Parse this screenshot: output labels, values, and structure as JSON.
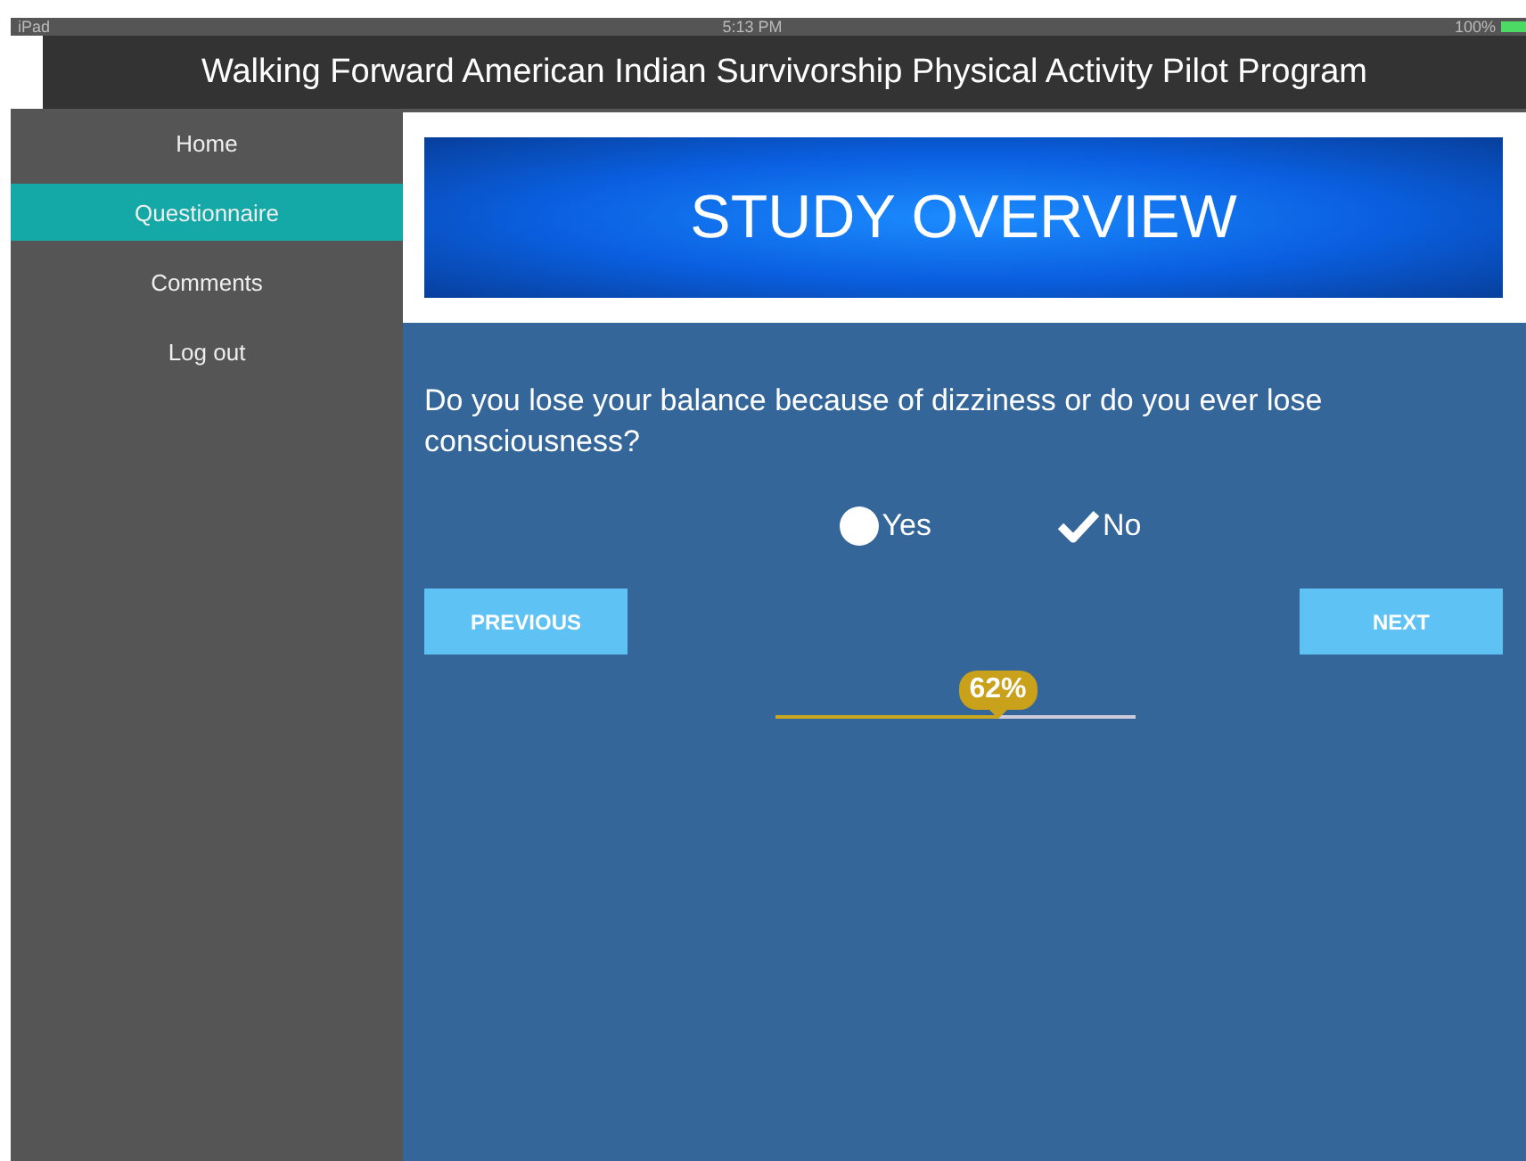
{
  "status_bar": {
    "device": "iPad",
    "time": "5:13 PM",
    "battery": "100%"
  },
  "header": {
    "title": "Walking Forward American Indian Survivorship Physical Activity Pilot Program"
  },
  "sidebar": {
    "items": [
      {
        "label": "Home",
        "selected": false
      },
      {
        "label": "Questionnaire",
        "selected": true
      },
      {
        "label": "Comments",
        "selected": false
      },
      {
        "label": "Log out",
        "selected": false
      }
    ]
  },
  "banner": {
    "title": "STUDY OVERVIEW"
  },
  "question": {
    "text": "Do you lose your balance because of dizziness or do you ever lose consciousness?",
    "options": [
      {
        "label": "Yes",
        "selected": false
      },
      {
        "label": "No",
        "selected": true
      }
    ]
  },
  "buttons": {
    "previous": "PREVIOUS",
    "next": "NEXT"
  },
  "progress": {
    "level": 0.62,
    "reading": "62%"
  }
}
